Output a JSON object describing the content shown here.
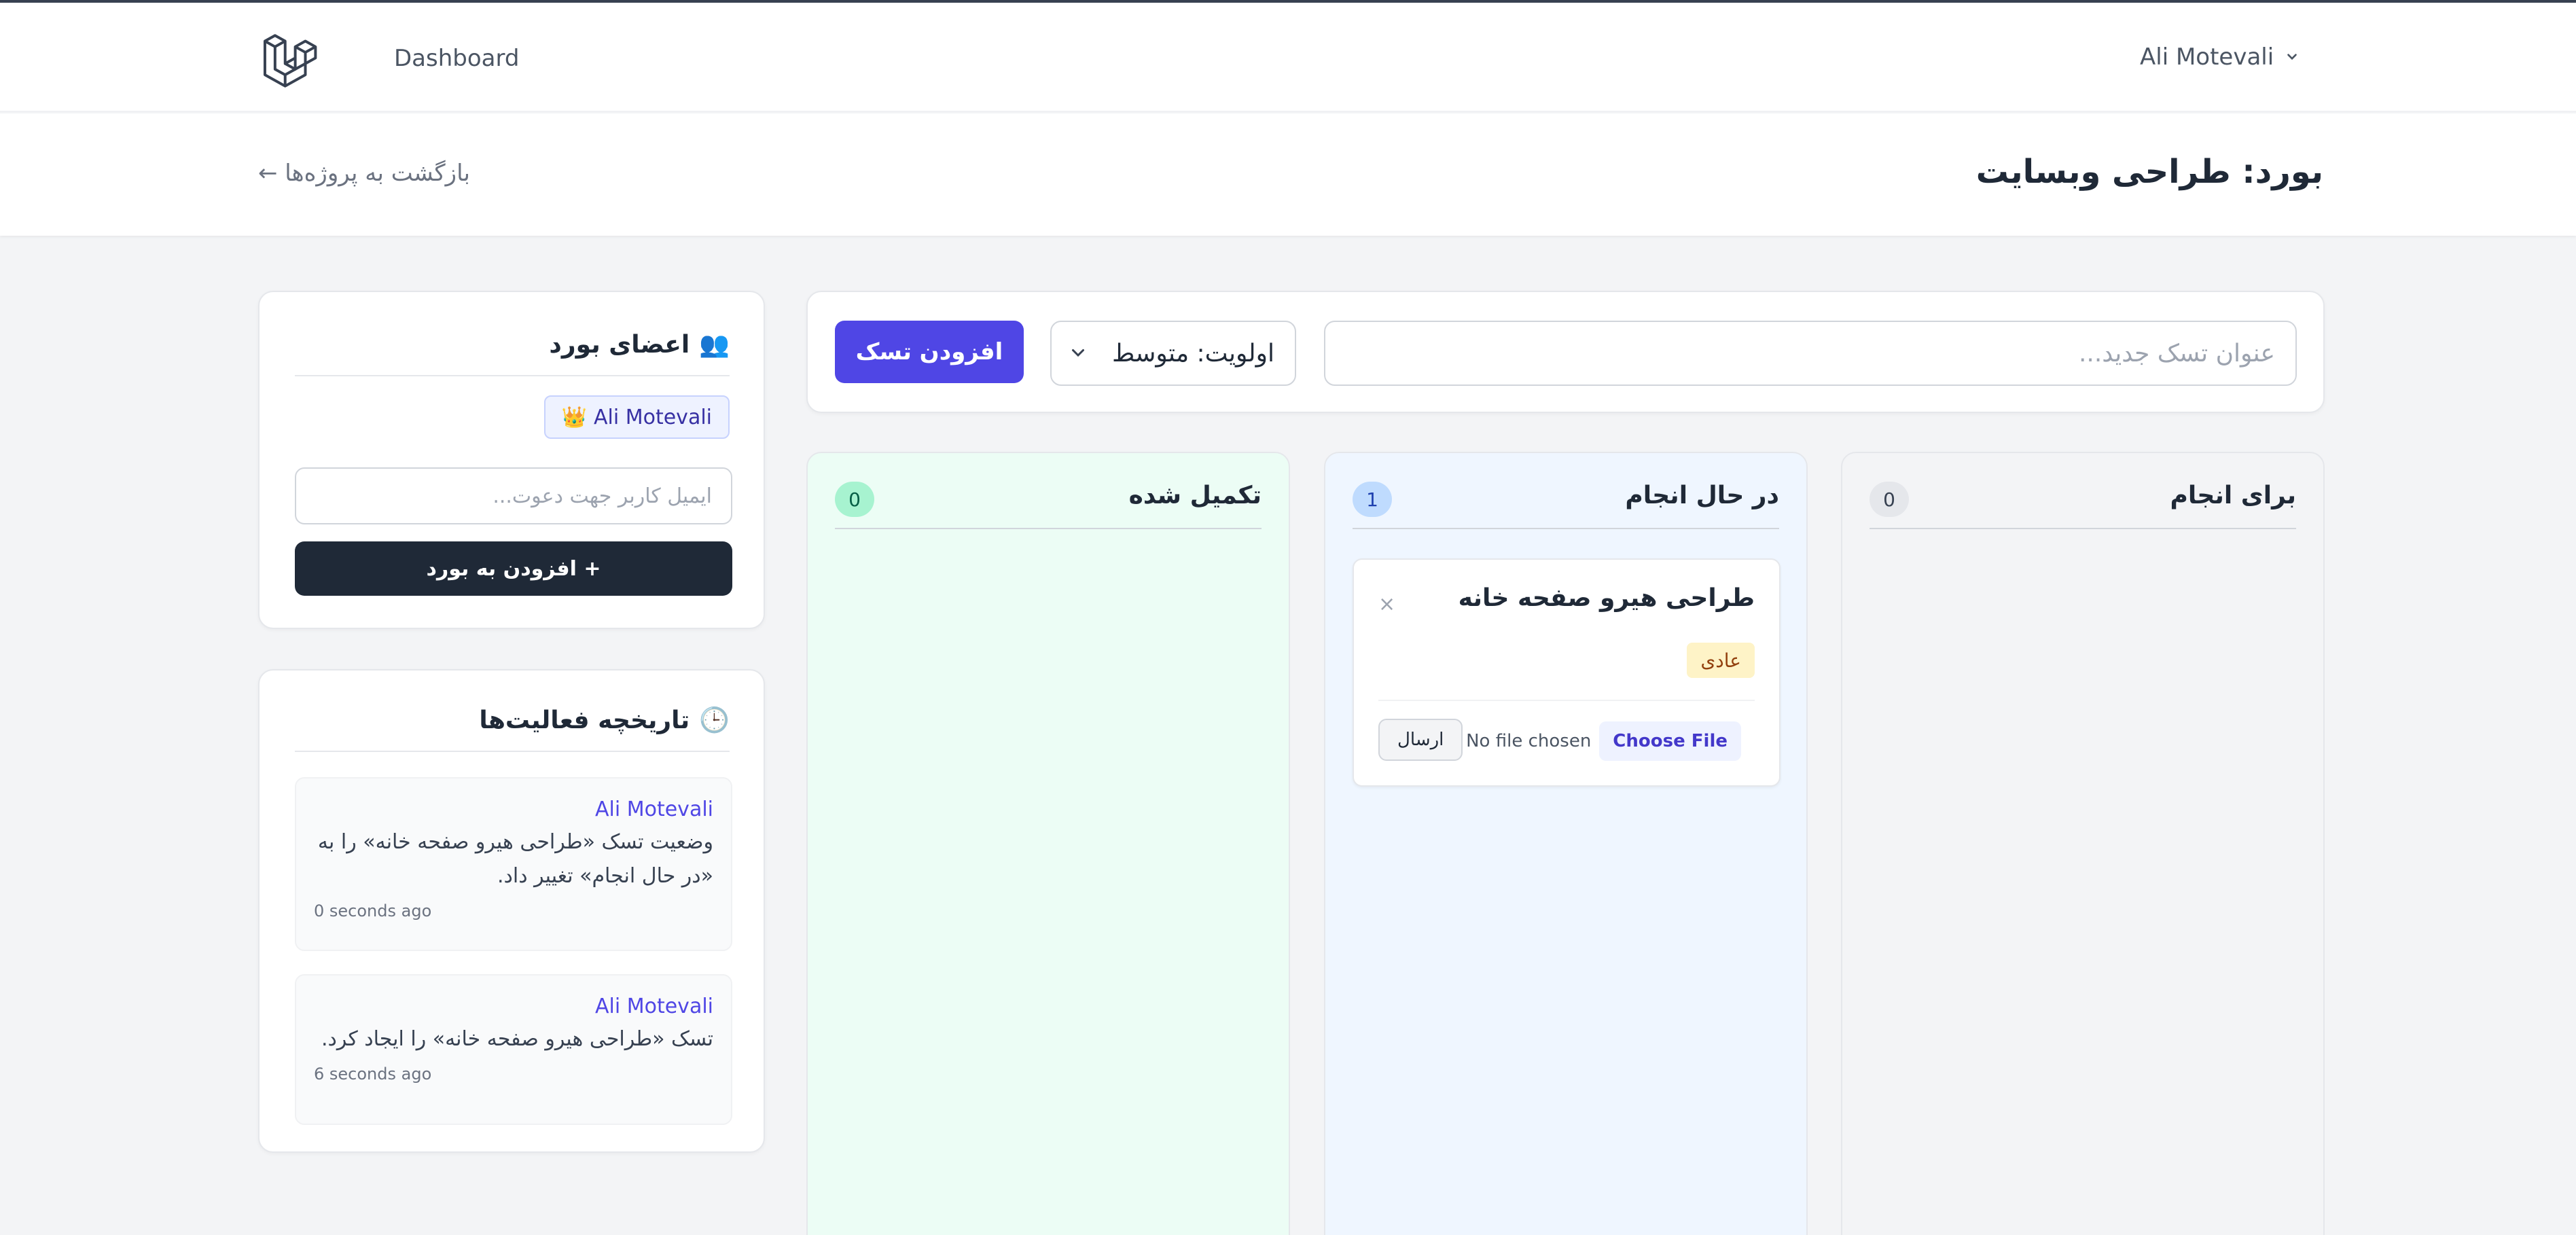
{
  "nav": {
    "dashboard_label": "Dashboard",
    "user_name": "Ali Motevali"
  },
  "header": {
    "title": "بورد: طراحی وبسایت",
    "back_label": "بازگشت به پروژه‌ها ←"
  },
  "members": {
    "title": "اعضای بورد",
    "icon": "👥",
    "member_name": "Ali Motevali",
    "owner_icon": "👑",
    "invite_placeholder": "ایمیل کاربر جهت دعوت...",
    "add_button": "+ افزودن به بورد"
  },
  "activity": {
    "title": "تاریخچه فعالیت‌ها",
    "icon": "🕒",
    "items": [
      {
        "user": "Ali Motevali",
        "text": "وضعیت تسک «طراحی هیرو صفحه خانه» را به «در حال انجام» تغییر داد.",
        "time": "0 seconds ago"
      },
      {
        "user": "Ali Motevali",
        "text": "تسک «طراحی هیرو صفحه خانه» را ایجاد کرد.",
        "time": "6 seconds ago"
      }
    ]
  },
  "add_task": {
    "title_placeholder": "عنوان تسک جدید...",
    "priority_selected": "اولویت: متوسط",
    "submit_label": "افزودن تسک"
  },
  "columns": {
    "done": {
      "title": "تکمیل شده",
      "count": "0"
    },
    "doing": {
      "title": "در حال انجام",
      "count": "1"
    },
    "todo": {
      "title": "برای انجام",
      "count": "0"
    }
  },
  "task": {
    "name": "طراحی هیرو صفحه خانه",
    "priority": "عادی",
    "close_symbol": "×",
    "choose_file": "Choose File",
    "no_file": "No file chosen",
    "send_label": "ارسال"
  }
}
